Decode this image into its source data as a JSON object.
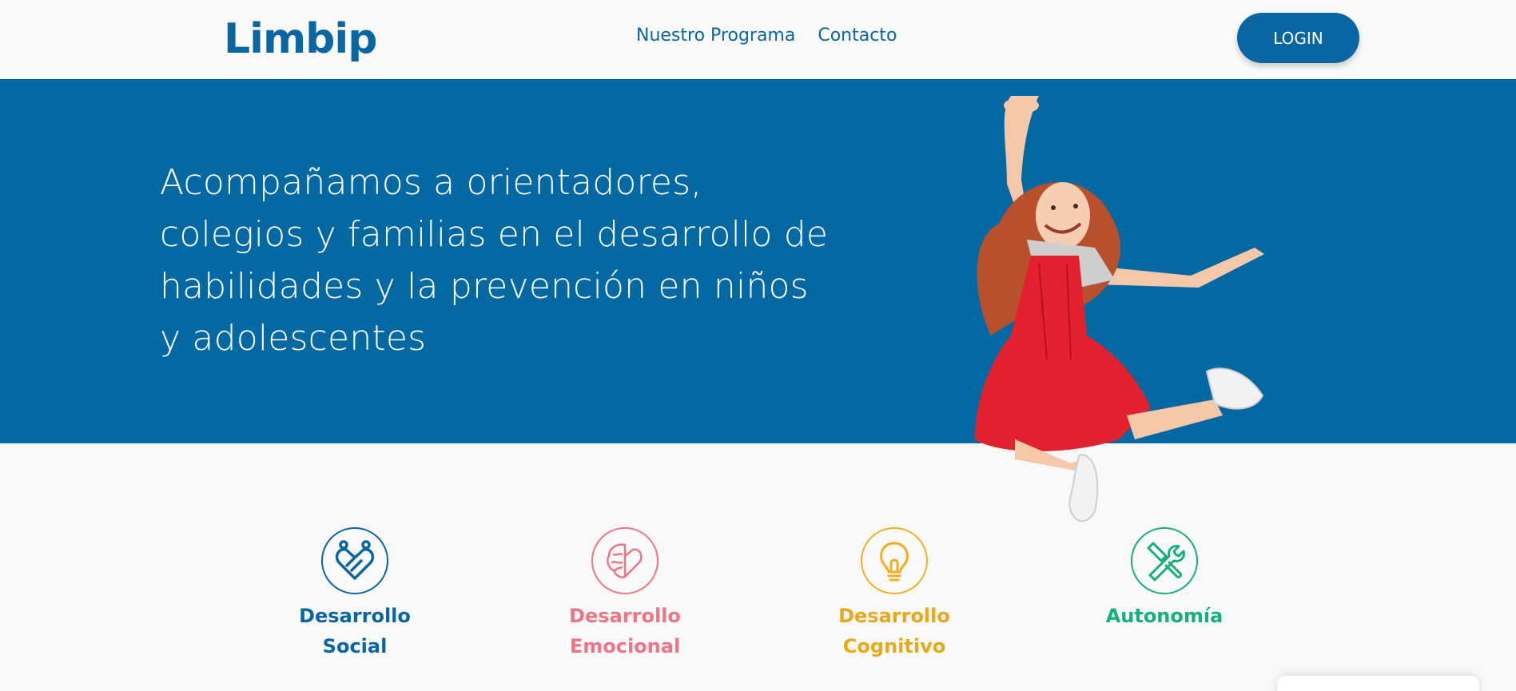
{
  "brand": {
    "name": "Limbip",
    "primary": "#0a66a3",
    "accent": "#f2a91e"
  },
  "nav": {
    "items": [
      {
        "label": "Nuestro Programa"
      },
      {
        "label": "Contacto"
      }
    ],
    "login_label": "LOGIN"
  },
  "hero": {
    "headline_lines": [
      "Acompañamos a orientadores,",
      "colegios y familias en el desarrollo de",
      "habilidades y la prevención en niños",
      "y adolescentes"
    ],
    "background": "#0469a3"
  },
  "features": [
    {
      "icon": "social-hearts-icon",
      "line1": "Desarrollo",
      "line2": "Social",
      "color": "#0a66a3"
    },
    {
      "icon": "brain-heart-icon",
      "line1": "Desarrollo",
      "line2": "Emocional",
      "color": "#ef7584"
    },
    {
      "icon": "lightbulb-icon",
      "line1": "Desarrollo",
      "line2": "Cognitivo",
      "color": "#f2b01e"
    },
    {
      "icon": "tools-icon",
      "line1": "Autonomía",
      "line2": "",
      "color": "#12b07a"
    }
  ]
}
